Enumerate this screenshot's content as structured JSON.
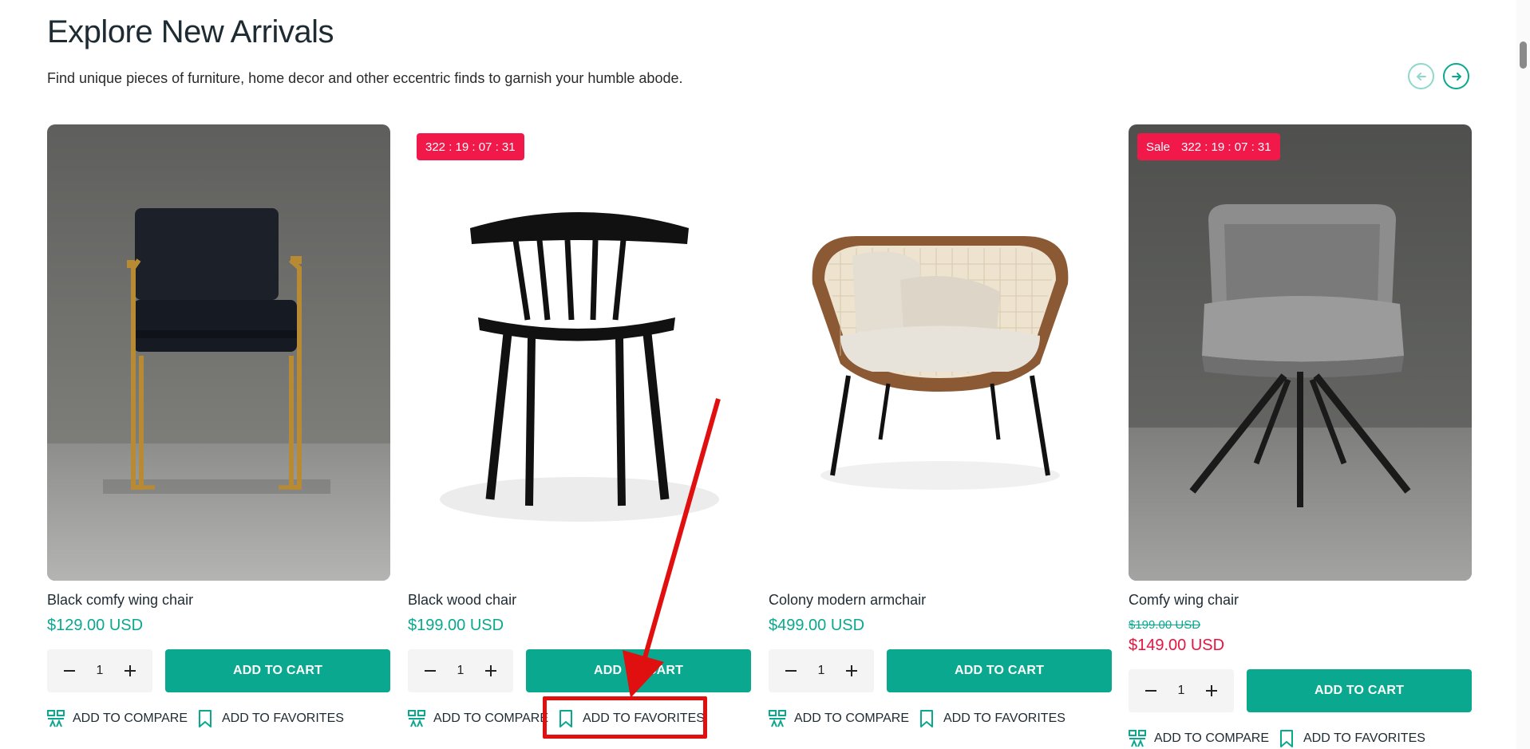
{
  "section": {
    "title": "Explore New Arrivals",
    "subtitle": "Find unique pieces of furniture, home decor and other eccentric finds to garnish your humble abode."
  },
  "colors": {
    "accent": "#0aa88f",
    "sale": "#f0194a",
    "highlight": "#e01010"
  },
  "nav": {
    "prev_icon": "arrow-left-icon",
    "next_icon": "arrow-right-icon"
  },
  "common": {
    "add_to_cart": "ADD TO CART",
    "add_to_compare": "ADD TO COMPARE",
    "add_to_favorites": "ADD TO FAVORITES",
    "compare_icon": "compare-icon",
    "favorites_icon": "bookmark-icon",
    "minus_icon": "minus-icon",
    "plus_icon": "plus-icon"
  },
  "products": [
    {
      "name": "Black comfy wing chair",
      "price": "$129.00 USD",
      "quantity": "1",
      "badge": null
    },
    {
      "name": "Black wood chair",
      "price": "$199.00 USD",
      "quantity": "1",
      "badge": {
        "label": "",
        "countdown": "322 : 19 : 07 : 31"
      }
    },
    {
      "name": "Colony modern armchair",
      "price": "$499.00 USD",
      "quantity": "1",
      "badge": null
    },
    {
      "name": "Comfy wing chair",
      "old_price": "$199.00 USD",
      "price": "$149.00 USD",
      "quantity": "1",
      "badge": {
        "label": "Sale",
        "countdown": "322 : 19 : 07 : 31"
      }
    }
  ]
}
